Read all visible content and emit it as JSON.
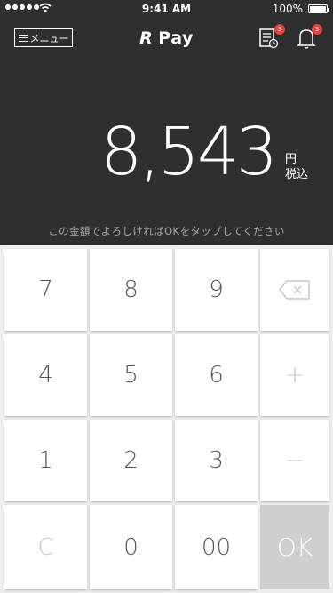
{
  "status_bar": {
    "time": "9:41 AM",
    "battery": "100%"
  },
  "header": {
    "menu_label": "メニュー",
    "logo": "Pay",
    "logo_mark": "R",
    "receipts_badge": "3",
    "notifications_badge": "3"
  },
  "display": {
    "amount": "8,543",
    "unit_line1": "円",
    "unit_line2": "税込",
    "hint": "この金額でよろしければOKをタップしてください"
  },
  "keypad": {
    "k7": "7",
    "k8": "8",
    "k9": "9",
    "k4": "4",
    "k5": "5",
    "k6": "6",
    "k1": "1",
    "k2": "2",
    "k3": "3",
    "clear": "C",
    "k0": "0",
    "k00": "00",
    "plus": "+",
    "minus": "−",
    "ok": "OK"
  },
  "colors": {
    "header_bg": "#2f2f2f",
    "badge": "#e8433b",
    "ok_bg": "#cfcfcf"
  }
}
